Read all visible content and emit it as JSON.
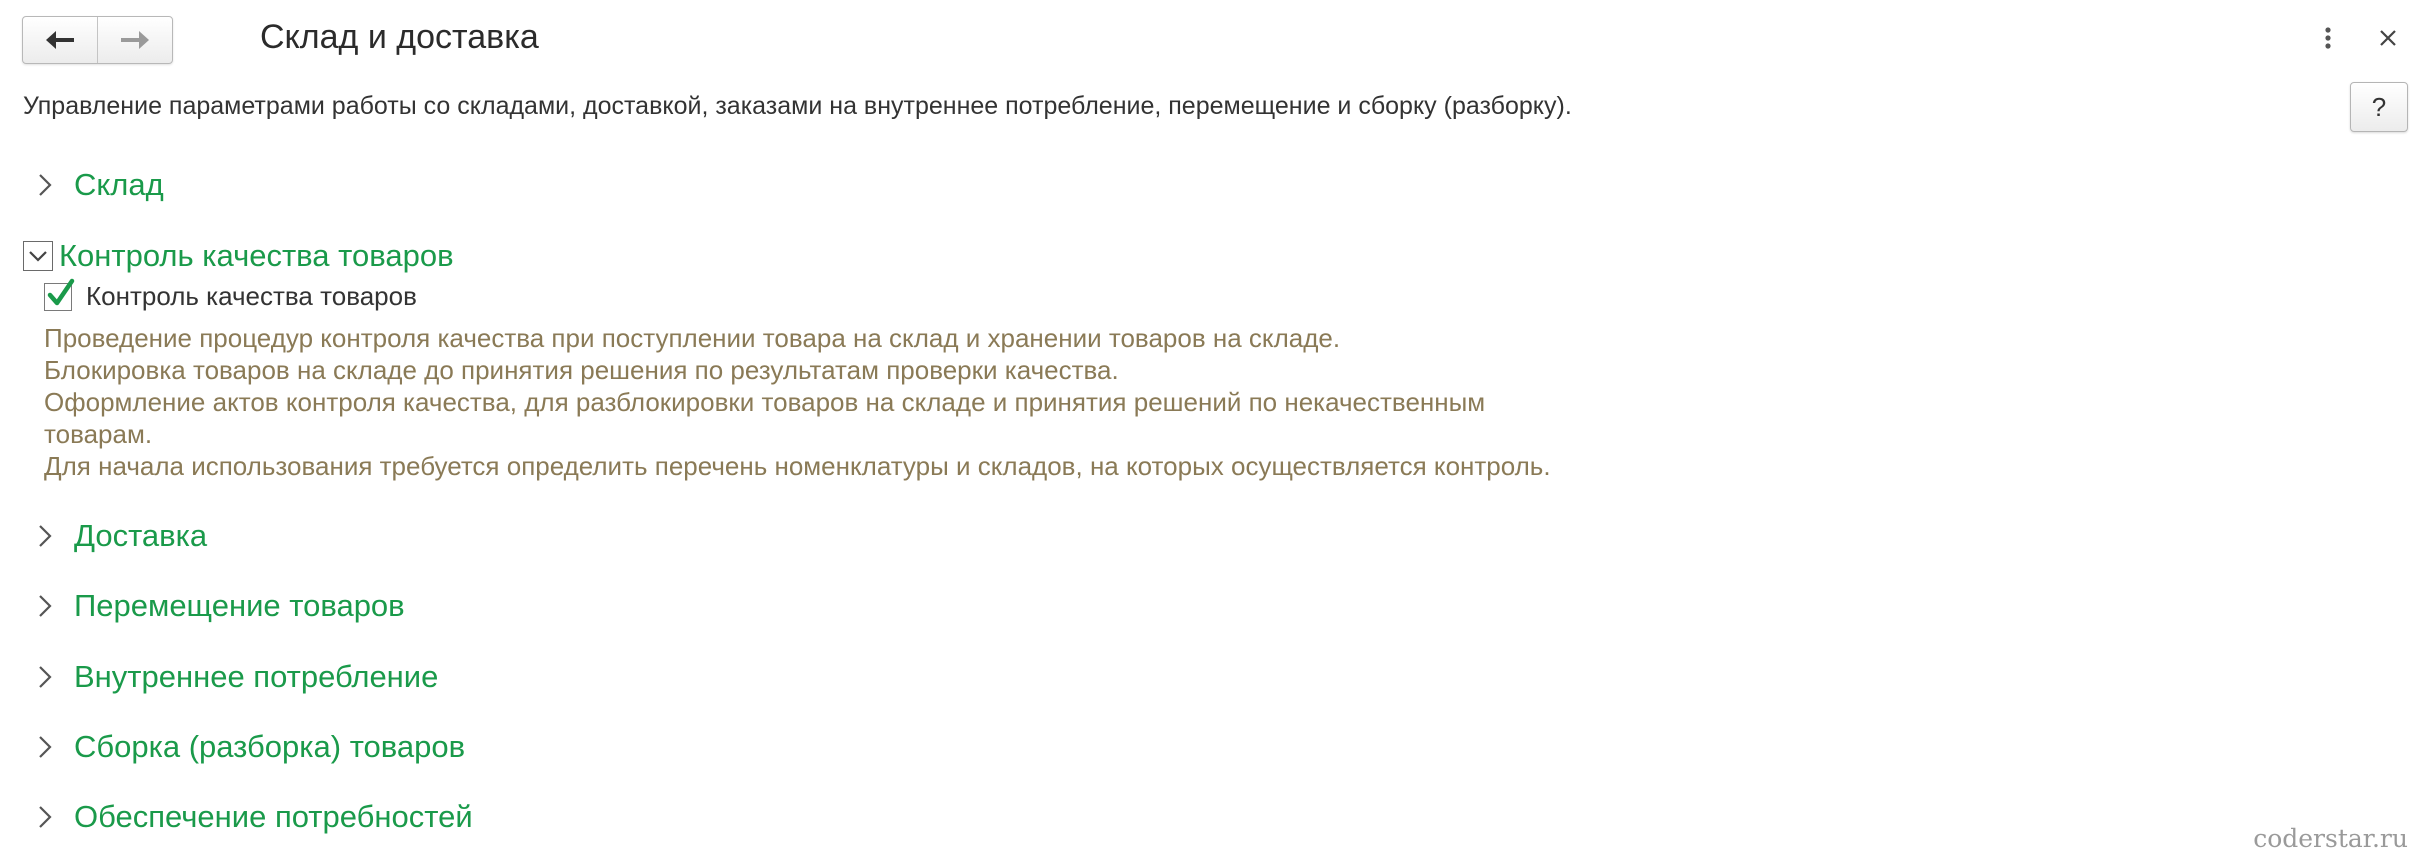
{
  "window": {
    "title": "Склад и доставка",
    "description": "Управление параметрами работы со складами, доставкой, заказами на внутреннее потребление, перемещение и сборку (разборку).",
    "help_label": "?"
  },
  "navigation": {
    "back_icon": "arrow-left-icon",
    "forward_icon": "arrow-right-icon"
  },
  "groups": {
    "warehouse": {
      "label": "Склад",
      "expanded": false
    },
    "quality": {
      "label": "Контроль качества товаров",
      "expanded": true,
      "checkbox": {
        "label": "Контроль качества товаров",
        "checked": true
      },
      "info_lines": [
        "Проведение процедур контроля качества при поступлении товара на склад и хранении товаров на складе.",
        "Блокировка товаров на складе до принятия решения по результатам проверки качества.",
        "Оформление актов контроля качества, для разблокировки товаров на складе и принятия решений по некачественным",
        "товарам.",
        "Для начала использования требуется определить перечень номенклатуры и складов, на которых осуществляется контроль."
      ]
    },
    "delivery": {
      "label": "Доставка",
      "expanded": false
    },
    "transfer": {
      "label": "Перемещение товаров",
      "expanded": false
    },
    "internal": {
      "label": "Внутреннее потребление",
      "expanded": false
    },
    "assembly": {
      "label": "Сборка (разборка) товаров",
      "expanded": false
    },
    "supply": {
      "label": "Обеспечение потребностей",
      "expanded": false
    }
  },
  "watermark": "coderstar.ru",
  "colors": {
    "group_header": "#1a9a4a",
    "info_text": "#8a7a56",
    "checkmark": "#1a9a4a"
  }
}
